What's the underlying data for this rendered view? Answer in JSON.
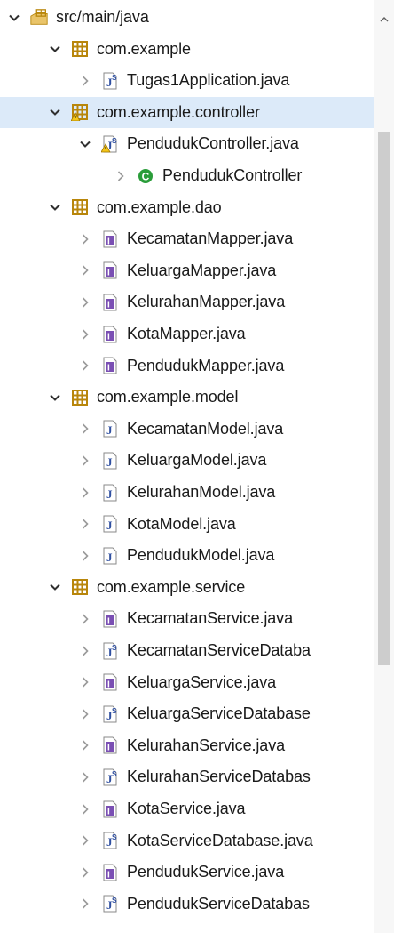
{
  "colors": {
    "selection": "#dceaf9",
    "package": "#b8860b",
    "interface": "#7a4fb3",
    "java_file": "#5b6fa8",
    "class_green": "#2a9d3a",
    "chevron": "#7a7a7a"
  },
  "tree": {
    "items": [
      {
        "label": "src/main/java",
        "level": 0,
        "expanded": true,
        "icon": "source-folder-icon"
      },
      {
        "label": "com.example",
        "level": 1,
        "expanded": true,
        "icon": "package-icon"
      },
      {
        "label": "Tugas1Application.java",
        "level": 2,
        "expanded": false,
        "icon": "java-springboot-file-icon"
      },
      {
        "label": "com.example.controller",
        "level": 1,
        "expanded": true,
        "icon": "package-warning-icon",
        "selected": true
      },
      {
        "label": "PendudukController.java",
        "level": 2,
        "expanded": true,
        "icon": "java-springboot-file-warning-icon"
      },
      {
        "label": "PendudukController",
        "level": 3,
        "expanded": false,
        "icon": "class-icon"
      },
      {
        "label": "com.example.dao",
        "level": 1,
        "expanded": true,
        "icon": "package-icon"
      },
      {
        "label": "KecamatanMapper.java",
        "level": 2,
        "expanded": false,
        "icon": "interface-file-icon"
      },
      {
        "label": "KeluargaMapper.java",
        "level": 2,
        "expanded": false,
        "icon": "interface-file-icon"
      },
      {
        "label": "KelurahanMapper.java",
        "level": 2,
        "expanded": false,
        "icon": "interface-file-icon"
      },
      {
        "label": "KotaMapper.java",
        "level": 2,
        "expanded": false,
        "icon": "interface-file-icon"
      },
      {
        "label": "PendudukMapper.java",
        "level": 2,
        "expanded": false,
        "icon": "interface-file-icon"
      },
      {
        "label": "com.example.model",
        "level": 1,
        "expanded": true,
        "icon": "package-icon"
      },
      {
        "label": "KecamatanModel.java",
        "level": 2,
        "expanded": false,
        "icon": "java-file-icon"
      },
      {
        "label": "KeluargaModel.java",
        "level": 2,
        "expanded": false,
        "icon": "java-file-icon"
      },
      {
        "label": "KelurahanModel.java",
        "level": 2,
        "expanded": false,
        "icon": "java-file-icon"
      },
      {
        "label": "KotaModel.java",
        "level": 2,
        "expanded": false,
        "icon": "java-file-icon"
      },
      {
        "label": "PendudukModel.java",
        "level": 2,
        "expanded": false,
        "icon": "java-file-icon"
      },
      {
        "label": "com.example.service",
        "level": 1,
        "expanded": true,
        "icon": "package-icon"
      },
      {
        "label": "KecamatanService.java",
        "level": 2,
        "expanded": false,
        "icon": "interface-file-icon"
      },
      {
        "label": "KecamatanServiceDataba",
        "level": 2,
        "expanded": false,
        "icon": "java-springboot-file-icon"
      },
      {
        "label": "KeluargaService.java",
        "level": 2,
        "expanded": false,
        "icon": "interface-file-icon"
      },
      {
        "label": "KeluargaServiceDatabase",
        "level": 2,
        "expanded": false,
        "icon": "java-springboot-file-icon"
      },
      {
        "label": "KelurahanService.java",
        "level": 2,
        "expanded": false,
        "icon": "interface-file-icon"
      },
      {
        "label": "KelurahanServiceDatabas",
        "level": 2,
        "expanded": false,
        "icon": "java-springboot-file-icon"
      },
      {
        "label": "KotaService.java",
        "level": 2,
        "expanded": false,
        "icon": "interface-file-icon"
      },
      {
        "label": "KotaServiceDatabase.java",
        "level": 2,
        "expanded": false,
        "icon": "java-springboot-file-icon"
      },
      {
        "label": "PendudukService.java",
        "level": 2,
        "expanded": false,
        "icon": "interface-file-icon"
      },
      {
        "label": "PendudukServiceDatabas",
        "level": 2,
        "expanded": false,
        "icon": "java-springboot-file-icon"
      }
    ]
  }
}
